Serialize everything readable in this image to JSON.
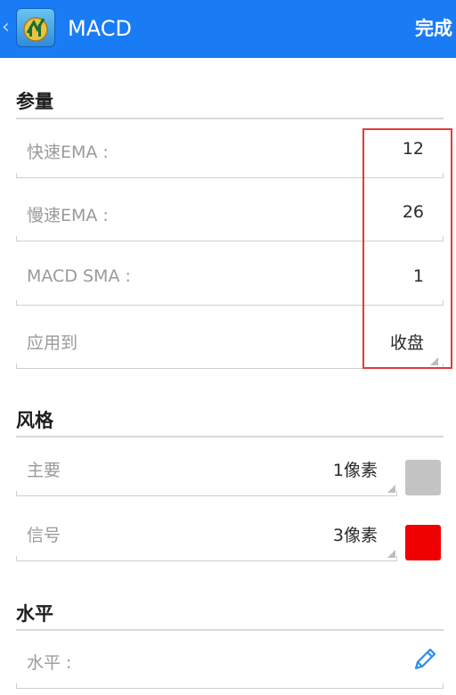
{
  "header": {
    "back_glyph": "‹",
    "title": "MACD",
    "done_label": "完成",
    "app_icon": "metatrader-app-icon"
  },
  "sections": {
    "params": {
      "title": "参量",
      "rows": [
        {
          "label": "快速EMA :",
          "value": "12"
        },
        {
          "label": "慢速EMA :",
          "value": "26"
        },
        {
          "label": "MACD SMA :",
          "value": "1"
        },
        {
          "label": "应用到",
          "value": "收盘"
        }
      ]
    },
    "style": {
      "title": "风格",
      "rows": [
        {
          "label": "主要",
          "value": "1像素",
          "color": "#c4c4c4"
        },
        {
          "label": "信号",
          "value": "3像素",
          "color": "#ee0000"
        }
      ]
    },
    "levels": {
      "title": "水平",
      "rows": [
        {
          "label": "水平 :",
          "icon": "pencil-icon"
        }
      ]
    }
  },
  "colors": {
    "header_bg": "#1a7cf5",
    "highlight_border": "#e23a3a",
    "pencil": "#2a8df0"
  }
}
